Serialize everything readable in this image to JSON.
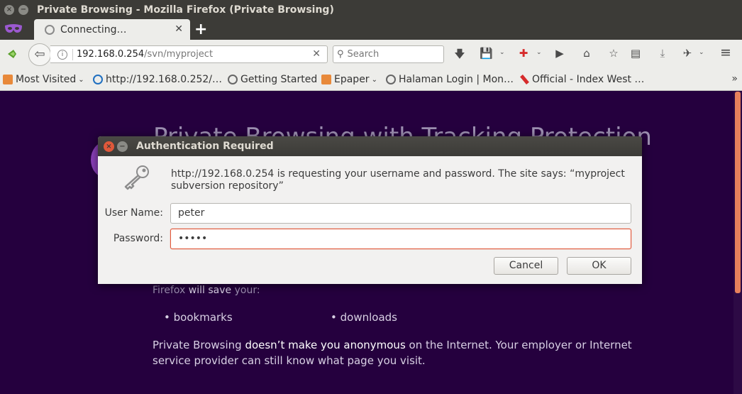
{
  "window": {
    "title": "Private Browsing - Mozilla Firefox (Private Browsing)",
    "close_glyph": "×",
    "min_glyph": "−"
  },
  "tab": {
    "label": "Connecting…",
    "close_glyph": "✕",
    "new_tab_glyph": "+"
  },
  "navbar": {
    "back_glyph": "⇦",
    "info_glyph": "i",
    "url_host": "192.168.0.254",
    "url_path": "/svn/myproject",
    "clear_glyph": "✕",
    "search_icon_glyph": "⚲",
    "search_placeholder": "Search",
    "icons": {
      "downloads_arrow": "🡇",
      "save": "💾",
      "dropdown": "⌄",
      "addon_red": "✚",
      "youtube": "▶",
      "home": "⌂",
      "bookmark_star": "☆",
      "reader": "▤",
      "download": "⤓",
      "extension": "✈",
      "menu": "≡"
    }
  },
  "bookmarks": [
    {
      "label": "Most Visited",
      "has_dropdown": true,
      "icon": "folder-icon"
    },
    {
      "label": "http://192.168.0.252/…",
      "icon": "globe-icon"
    },
    {
      "label": "Getting Started",
      "icon": "globe-icon"
    },
    {
      "label": "Epaper",
      "has_dropdown": true,
      "icon": "folder-icon"
    },
    {
      "label": "Halaman Login | Mon…",
      "icon": "globe-icon"
    },
    {
      "label": "Official - Index West …",
      "icon": "pen-icon"
    }
  ],
  "bookmarks_dropdown_glyph": "⌄",
  "bookmarks_overflow_glyph": "»",
  "private_page": {
    "heading": "Private Browsing with Tracking Protection",
    "firefox_will_save_prefix": "Firefox",
    "firefox_will_save_strong": "will save",
    "firefox_will_save_suffix": "your:",
    "bullets": [
      "bookmarks",
      "downloads"
    ],
    "bullet_glyph": "•",
    "para_prefix": "Private Browsing",
    "para_strong": "doesn’t make you anonymous",
    "para_suffix": "on the Internet. Your employer or Internet service provider can still know what page you visit."
  },
  "dialog": {
    "title": "Authentication Required",
    "close_glyph": "×",
    "min_glyph": "−",
    "message": "http://192.168.0.254 is requesting your username and password. The site says: “myproject subversion repository”",
    "username_label": "User Name:",
    "username_value": "peter",
    "password_label": "Password:",
    "password_value": "•••••",
    "cancel_label": "Cancel",
    "ok_label": "OK"
  },
  "colors": {
    "page_bg": "#25003e",
    "accent_orange": "#e0583a",
    "chrome_dark": "#3c3b37",
    "toolbar_bg": "#ededea"
  }
}
